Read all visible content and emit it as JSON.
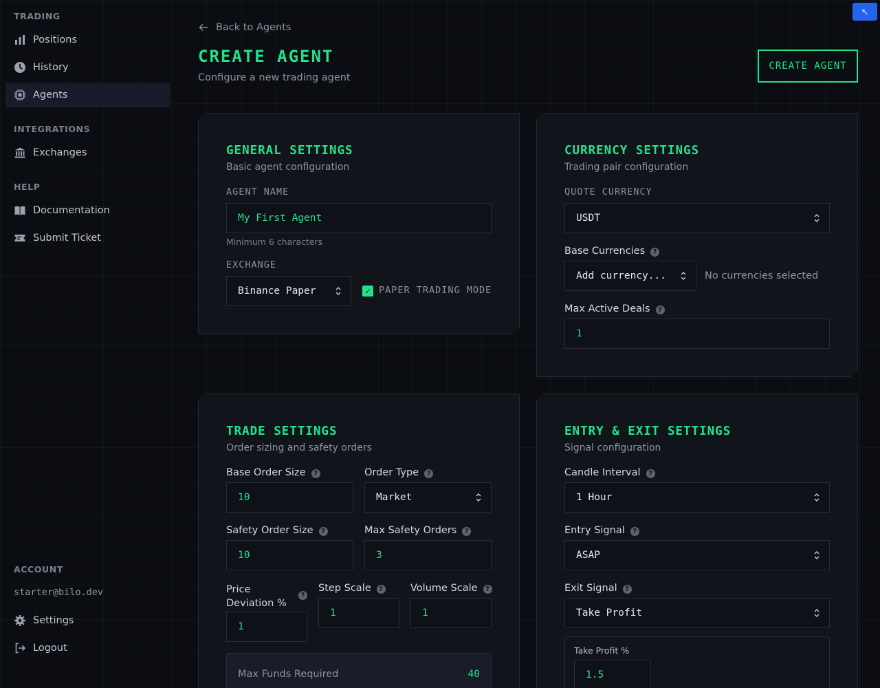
{
  "sidebar": {
    "sections": [
      {
        "heading": "TRADING",
        "items": [
          {
            "label": "Positions",
            "icon": "bar-chart-icon"
          },
          {
            "label": "History",
            "icon": "clock-icon"
          },
          {
            "label": "Agents",
            "icon": "cpu-chip-icon",
            "active": true
          }
        ]
      },
      {
        "heading": "INTEGRATIONS",
        "items": [
          {
            "label": "Exchanges",
            "icon": "bank-icon"
          }
        ]
      },
      {
        "heading": "HELP",
        "items": [
          {
            "label": "Documentation",
            "icon": "book-icon"
          },
          {
            "label": "Submit Ticket",
            "icon": "ticket-icon"
          }
        ]
      }
    ],
    "account": {
      "heading": "ACCOUNT",
      "email": "starter@bilo.dev",
      "settings": "Settings",
      "logout": "Logout"
    }
  },
  "header": {
    "back": "Back to Agents",
    "title": "CREATE AGENT",
    "subtitle": "Configure a new trading agent",
    "create_button": "CREATE AGENT",
    "corner_badge": "↖"
  },
  "general": {
    "title": "GENERAL SETTINGS",
    "subtitle": "Basic agent configuration",
    "agent_name_label": "AGENT NAME",
    "agent_name_value": "My First Agent",
    "agent_name_hint": "Minimum 6 characters",
    "exchange_label": "EXCHANGE",
    "exchange_value": "Binance Paper",
    "paper_mode_label": "PAPER TRADING MODE",
    "paper_mode_checked": true
  },
  "currency": {
    "title": "CURRENCY SETTINGS",
    "subtitle": "Trading pair configuration",
    "quote_label": "QUOTE CURRENCY",
    "quote_value": "USDT",
    "base_label": "Base Currencies",
    "base_placeholder": "Add currency...",
    "base_empty": "No currencies selected",
    "max_deals_label": "Max Active Deals",
    "max_deals_value": "1"
  },
  "trade": {
    "title": "TRADE SETTINGS",
    "subtitle": "Order sizing and safety orders",
    "base_order_label": "Base Order Size",
    "base_order_value": "10",
    "order_type_label": "Order Type",
    "order_type_value": "Market",
    "safety_order_label": "Safety Order Size",
    "safety_order_value": "10",
    "max_safety_label": "Max Safety Orders",
    "max_safety_value": "3",
    "price_dev_label": "Price Deviation %",
    "price_dev_value": "1",
    "step_scale_label": "Step Scale",
    "step_scale_value": "1",
    "volume_scale_label": "Volume Scale",
    "volume_scale_value": "1",
    "max_funds_label": "Max Funds Required",
    "max_funds_value": "40"
  },
  "entry_exit": {
    "title": "ENTRY & EXIT SETTINGS",
    "subtitle": "Signal configuration",
    "candle_label": "Candle Interval",
    "candle_value": "1 Hour",
    "entry_label": "Entry Signal",
    "entry_value": "ASAP",
    "exit_label": "Exit Signal",
    "exit_value": "Take Profit",
    "take_profit_label": "Take Profit %",
    "take_profit_value": "1.5"
  },
  "help_glyph": "?",
  "check_glyph": "✓"
}
